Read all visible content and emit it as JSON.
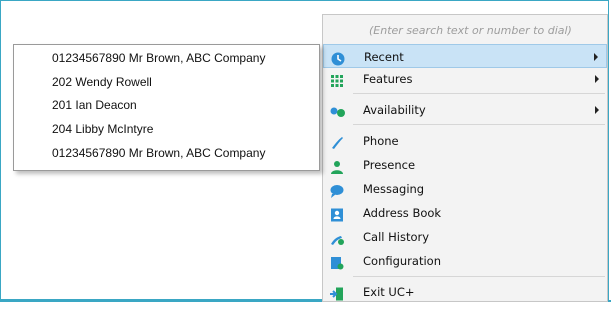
{
  "search": {
    "placeholder": "(Enter search text or number to dial)"
  },
  "menu": {
    "items": [
      {
        "label": "Recent",
        "icon": "clock-icon",
        "submenu": true,
        "highlighted": true
      },
      {
        "label": "Features",
        "icon": "grid-icon",
        "submenu": true
      },
      {
        "label": "Availability",
        "icon": "availability-icon",
        "submenu": true
      },
      {
        "label": "Phone",
        "icon": "phone-icon"
      },
      {
        "label": "Presence",
        "icon": "person-icon"
      },
      {
        "label": "Messaging",
        "icon": "chat-bubble-icon"
      },
      {
        "label": "Address Book",
        "icon": "address-book-icon"
      },
      {
        "label": "Call History",
        "icon": "call-history-icon"
      },
      {
        "label": "Configuration",
        "icon": "configuration-icon"
      },
      {
        "label": "Exit UC+",
        "icon": "exit-door-icon"
      }
    ]
  },
  "recent": {
    "items": [
      {
        "label": "01234567890  Mr Brown, ABC Company"
      },
      {
        "label": "202  Wendy Rowell"
      },
      {
        "label": "201  Ian Deacon"
      },
      {
        "label": "204  Libby McIntyre"
      },
      {
        "label": "01234567890  Mr Brown, ABC Company"
      }
    ]
  },
  "colors": {
    "accent": "#3aa7c4",
    "highlight": "#c9e3f6",
    "icon_blue": "#2f8fd6",
    "icon_green": "#22a45a"
  }
}
